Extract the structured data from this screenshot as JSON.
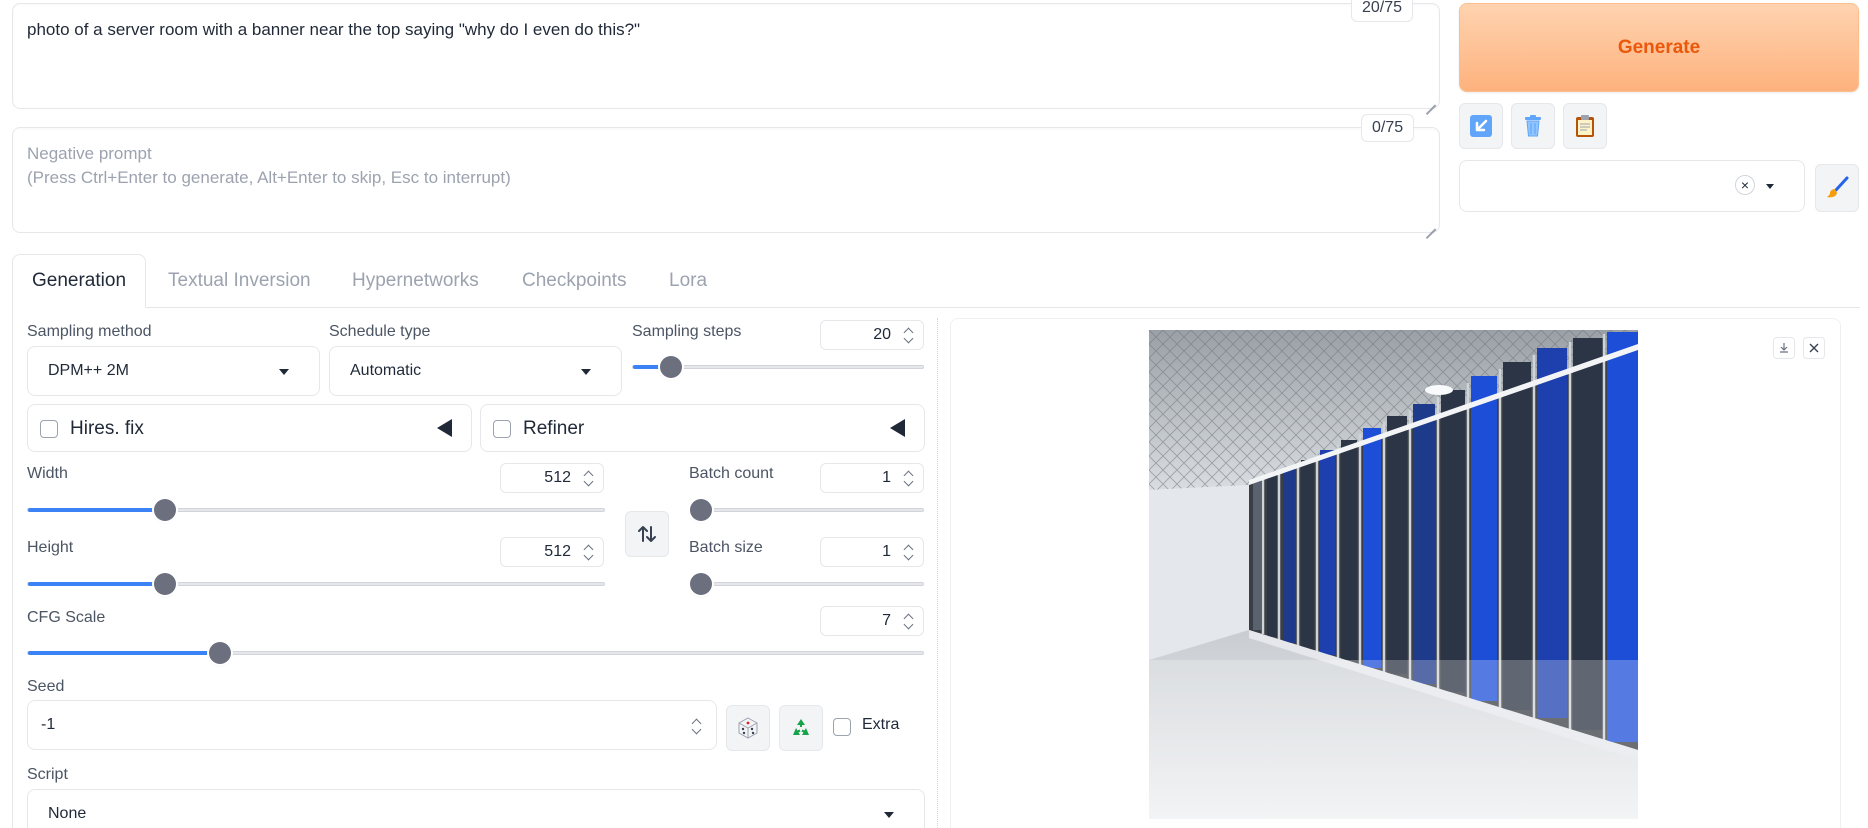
{
  "prompt": {
    "value": "photo of a server room with a banner near the top saying \"why do I even do this?\"",
    "token_count": "20/75"
  },
  "negative_prompt": {
    "placeholder_line1": "Negative prompt",
    "placeholder_line2": "(Press Ctrl+Enter to generate, Alt+Enter to skip, Esc to interrupt)",
    "token_count": "0/75"
  },
  "actions": {
    "generate_label": "Generate",
    "tool_icons": [
      "arrow-down-left-icon",
      "trash-icon",
      "clipboard-icon"
    ],
    "style_clear": "×",
    "brush_icon": "paintbrush-icon"
  },
  "tabs": [
    {
      "label": "Generation",
      "active": true
    },
    {
      "label": "Textual Inversion",
      "active": false
    },
    {
      "label": "Hypernetworks",
      "active": false
    },
    {
      "label": "Checkpoints",
      "active": false
    },
    {
      "label": "Lora",
      "active": false
    }
  ],
  "generation": {
    "sampling_method": {
      "label": "Sampling method",
      "value": "DPM++ 2M"
    },
    "schedule_type": {
      "label": "Schedule type",
      "value": "Automatic"
    },
    "sampling_steps": {
      "label": "Sampling steps",
      "value": "20",
      "fraction": 0.13
    },
    "hires_fix": {
      "label": "Hires. fix",
      "checked": false
    },
    "refiner": {
      "label": "Refiner",
      "checked": false
    },
    "width": {
      "label": "Width",
      "value": "512",
      "fraction": 0.238
    },
    "height": {
      "label": "Height",
      "value": "512",
      "fraction": 0.238
    },
    "batch_count": {
      "label": "Batch count",
      "value": "1",
      "fraction": 0.0
    },
    "batch_size": {
      "label": "Batch size",
      "value": "1",
      "fraction": 0.0
    },
    "cfg_scale": {
      "label": "CFG Scale",
      "value": "7",
      "fraction": 0.215
    },
    "seed": {
      "label": "Seed",
      "value": "-1"
    },
    "extra": {
      "label": "Extra",
      "checked": false
    },
    "script": {
      "label": "Script",
      "value": "None"
    }
  },
  "colors": {
    "accent": "#3b82f6",
    "generate_text": "#ea580c",
    "generate_bg": "#fdb27d"
  }
}
